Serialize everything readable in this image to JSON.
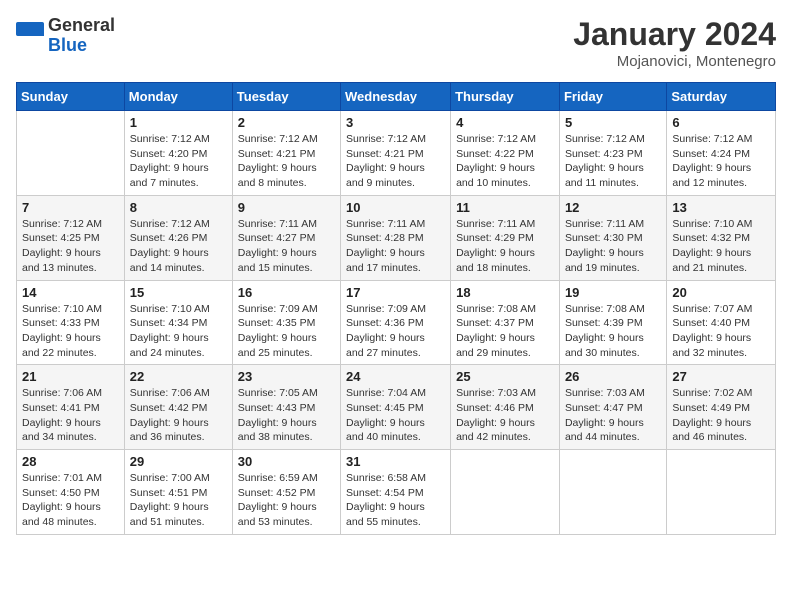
{
  "header": {
    "logo_general": "General",
    "logo_blue": "Blue",
    "month_title": "January 2024",
    "location": "Mojanovici, Montenegro"
  },
  "days_of_week": [
    "Sunday",
    "Monday",
    "Tuesday",
    "Wednesday",
    "Thursday",
    "Friday",
    "Saturday"
  ],
  "weeks": [
    [
      {
        "day": "",
        "sunrise": "",
        "sunset": "",
        "daylight": ""
      },
      {
        "day": "1",
        "sunrise": "Sunrise: 7:12 AM",
        "sunset": "Sunset: 4:20 PM",
        "daylight": "Daylight: 9 hours and 7 minutes."
      },
      {
        "day": "2",
        "sunrise": "Sunrise: 7:12 AM",
        "sunset": "Sunset: 4:21 PM",
        "daylight": "Daylight: 9 hours and 8 minutes."
      },
      {
        "day": "3",
        "sunrise": "Sunrise: 7:12 AM",
        "sunset": "Sunset: 4:21 PM",
        "daylight": "Daylight: 9 hours and 9 minutes."
      },
      {
        "day": "4",
        "sunrise": "Sunrise: 7:12 AM",
        "sunset": "Sunset: 4:22 PM",
        "daylight": "Daylight: 9 hours and 10 minutes."
      },
      {
        "day": "5",
        "sunrise": "Sunrise: 7:12 AM",
        "sunset": "Sunset: 4:23 PM",
        "daylight": "Daylight: 9 hours and 11 minutes."
      },
      {
        "day": "6",
        "sunrise": "Sunrise: 7:12 AM",
        "sunset": "Sunset: 4:24 PM",
        "daylight": "Daylight: 9 hours and 12 minutes."
      }
    ],
    [
      {
        "day": "7",
        "sunrise": "Sunrise: 7:12 AM",
        "sunset": "Sunset: 4:25 PM",
        "daylight": "Daylight: 9 hours and 13 minutes."
      },
      {
        "day": "8",
        "sunrise": "Sunrise: 7:12 AM",
        "sunset": "Sunset: 4:26 PM",
        "daylight": "Daylight: 9 hours and 14 minutes."
      },
      {
        "day": "9",
        "sunrise": "Sunrise: 7:11 AM",
        "sunset": "Sunset: 4:27 PM",
        "daylight": "Daylight: 9 hours and 15 minutes."
      },
      {
        "day": "10",
        "sunrise": "Sunrise: 7:11 AM",
        "sunset": "Sunset: 4:28 PM",
        "daylight": "Daylight: 9 hours and 17 minutes."
      },
      {
        "day": "11",
        "sunrise": "Sunrise: 7:11 AM",
        "sunset": "Sunset: 4:29 PM",
        "daylight": "Daylight: 9 hours and 18 minutes."
      },
      {
        "day": "12",
        "sunrise": "Sunrise: 7:11 AM",
        "sunset": "Sunset: 4:30 PM",
        "daylight": "Daylight: 9 hours and 19 minutes."
      },
      {
        "day": "13",
        "sunrise": "Sunrise: 7:10 AM",
        "sunset": "Sunset: 4:32 PM",
        "daylight": "Daylight: 9 hours and 21 minutes."
      }
    ],
    [
      {
        "day": "14",
        "sunrise": "Sunrise: 7:10 AM",
        "sunset": "Sunset: 4:33 PM",
        "daylight": "Daylight: 9 hours and 22 minutes."
      },
      {
        "day": "15",
        "sunrise": "Sunrise: 7:10 AM",
        "sunset": "Sunset: 4:34 PM",
        "daylight": "Daylight: 9 hours and 24 minutes."
      },
      {
        "day": "16",
        "sunrise": "Sunrise: 7:09 AM",
        "sunset": "Sunset: 4:35 PM",
        "daylight": "Daylight: 9 hours and 25 minutes."
      },
      {
        "day": "17",
        "sunrise": "Sunrise: 7:09 AM",
        "sunset": "Sunset: 4:36 PM",
        "daylight": "Daylight: 9 hours and 27 minutes."
      },
      {
        "day": "18",
        "sunrise": "Sunrise: 7:08 AM",
        "sunset": "Sunset: 4:37 PM",
        "daylight": "Daylight: 9 hours and 29 minutes."
      },
      {
        "day": "19",
        "sunrise": "Sunrise: 7:08 AM",
        "sunset": "Sunset: 4:39 PM",
        "daylight": "Daylight: 9 hours and 30 minutes."
      },
      {
        "day": "20",
        "sunrise": "Sunrise: 7:07 AM",
        "sunset": "Sunset: 4:40 PM",
        "daylight": "Daylight: 9 hours and 32 minutes."
      }
    ],
    [
      {
        "day": "21",
        "sunrise": "Sunrise: 7:06 AM",
        "sunset": "Sunset: 4:41 PM",
        "daylight": "Daylight: 9 hours and 34 minutes."
      },
      {
        "day": "22",
        "sunrise": "Sunrise: 7:06 AM",
        "sunset": "Sunset: 4:42 PM",
        "daylight": "Daylight: 9 hours and 36 minutes."
      },
      {
        "day": "23",
        "sunrise": "Sunrise: 7:05 AM",
        "sunset": "Sunset: 4:43 PM",
        "daylight": "Daylight: 9 hours and 38 minutes."
      },
      {
        "day": "24",
        "sunrise": "Sunrise: 7:04 AM",
        "sunset": "Sunset: 4:45 PM",
        "daylight": "Daylight: 9 hours and 40 minutes."
      },
      {
        "day": "25",
        "sunrise": "Sunrise: 7:03 AM",
        "sunset": "Sunset: 4:46 PM",
        "daylight": "Daylight: 9 hours and 42 minutes."
      },
      {
        "day": "26",
        "sunrise": "Sunrise: 7:03 AM",
        "sunset": "Sunset: 4:47 PM",
        "daylight": "Daylight: 9 hours and 44 minutes."
      },
      {
        "day": "27",
        "sunrise": "Sunrise: 7:02 AM",
        "sunset": "Sunset: 4:49 PM",
        "daylight": "Daylight: 9 hours and 46 minutes."
      }
    ],
    [
      {
        "day": "28",
        "sunrise": "Sunrise: 7:01 AM",
        "sunset": "Sunset: 4:50 PM",
        "daylight": "Daylight: 9 hours and 48 minutes."
      },
      {
        "day": "29",
        "sunrise": "Sunrise: 7:00 AM",
        "sunset": "Sunset: 4:51 PM",
        "daylight": "Daylight: 9 hours and 51 minutes."
      },
      {
        "day": "30",
        "sunrise": "Sunrise: 6:59 AM",
        "sunset": "Sunset: 4:52 PM",
        "daylight": "Daylight: 9 hours and 53 minutes."
      },
      {
        "day": "31",
        "sunrise": "Sunrise: 6:58 AM",
        "sunset": "Sunset: 4:54 PM",
        "daylight": "Daylight: 9 hours and 55 minutes."
      },
      {
        "day": "",
        "sunrise": "",
        "sunset": "",
        "daylight": ""
      },
      {
        "day": "",
        "sunrise": "",
        "sunset": "",
        "daylight": ""
      },
      {
        "day": "",
        "sunrise": "",
        "sunset": "",
        "daylight": ""
      }
    ]
  ]
}
